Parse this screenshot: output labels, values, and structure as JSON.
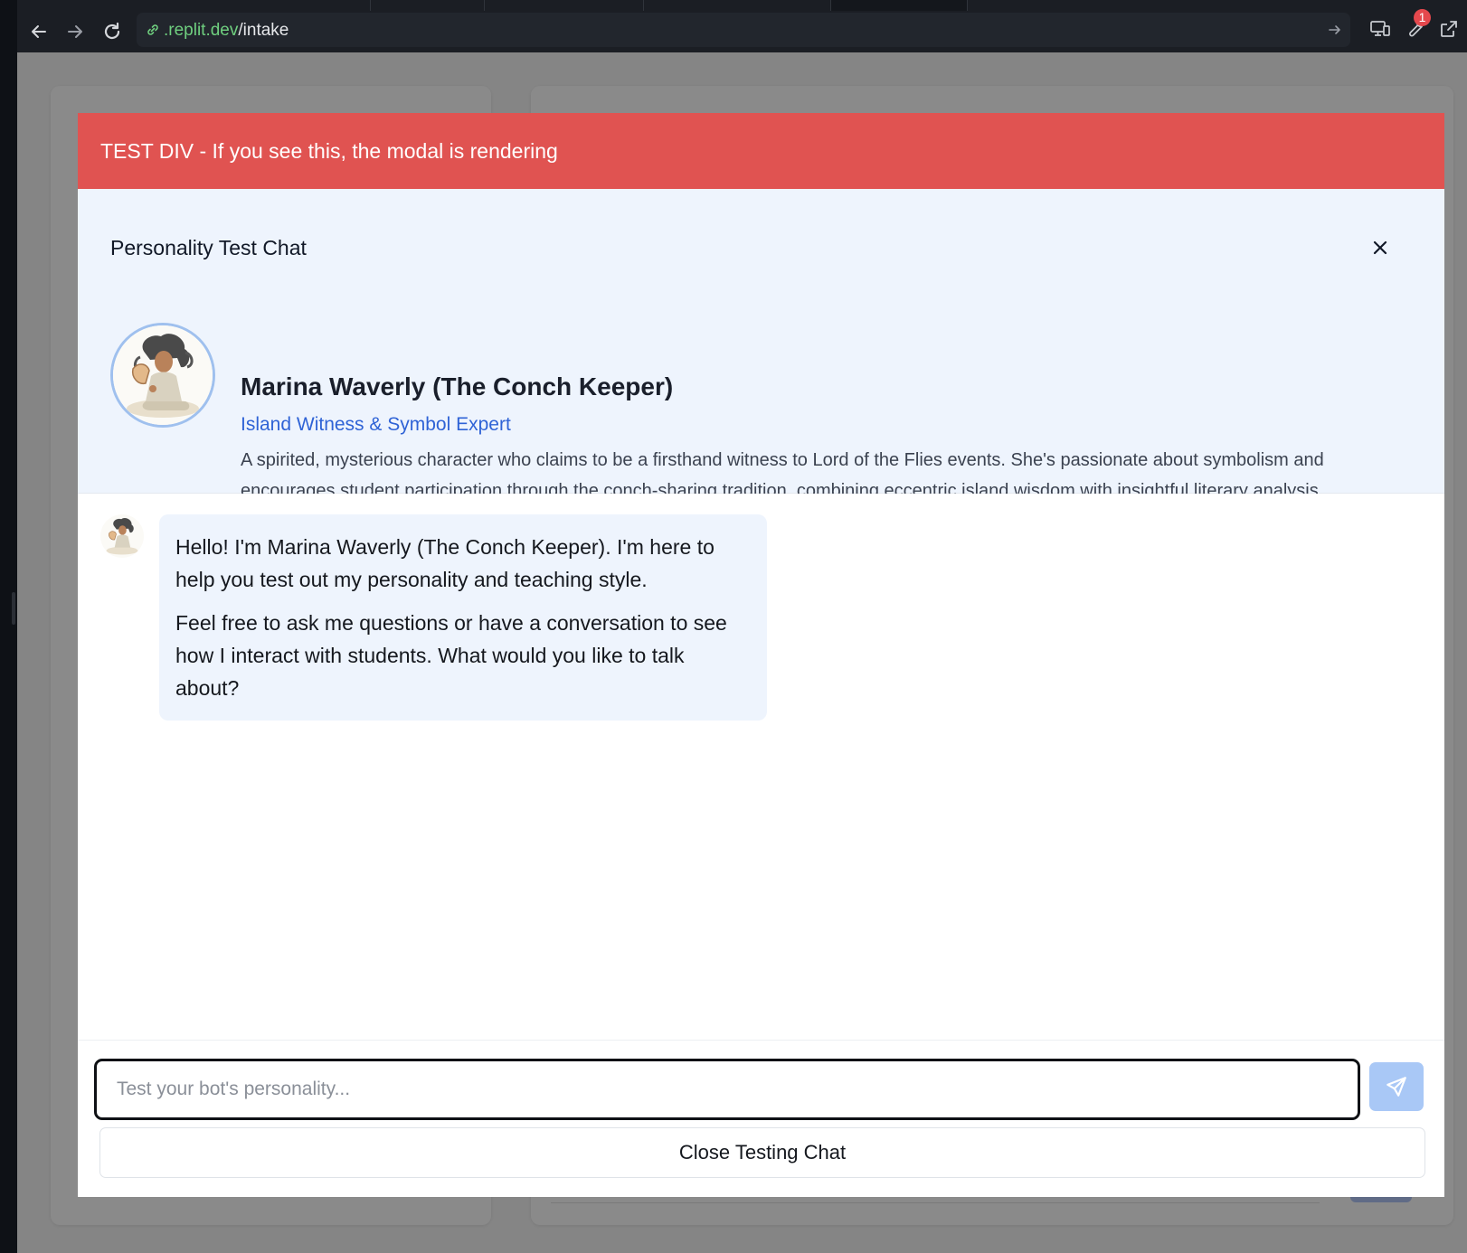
{
  "browser": {
    "url_prefix": ".replit.dev",
    "url_path": "/intake",
    "notification_count": "1"
  },
  "modal": {
    "test_banner": "TEST DIV - If you see this, the modal is rendering",
    "title": "Personality Test Chat",
    "bot": {
      "name": "Marina Waverly (The Conch Keeper)",
      "role": "Island Witness & Symbol Expert",
      "description": "A spirited, mysterious character who claims to be a firsthand witness to Lord of the Flies events. She's passionate about symbolism and encourages student participation through the conch-sharing tradition, combining eccentric island wisdom with insightful literary analysis."
    },
    "messages": [
      {
        "sender": "bot",
        "paragraphs": [
          "Hello! I'm Marina Waverly (The Conch Keeper). I'm here to help you test out my personality and teaching style.",
          "Feel free to ask me questions or have a conversation to see how I interact with students. What would you like to talk about?"
        ]
      }
    ],
    "input": {
      "placeholder": "Test your bot's personality...",
      "value": ""
    },
    "close_button_label": "Close Testing Chat"
  },
  "colors": {
    "banner": "#e05351",
    "header_bg": "#eef4fd",
    "accent": "#2f63d6",
    "send_button": "#a9c8f6"
  }
}
